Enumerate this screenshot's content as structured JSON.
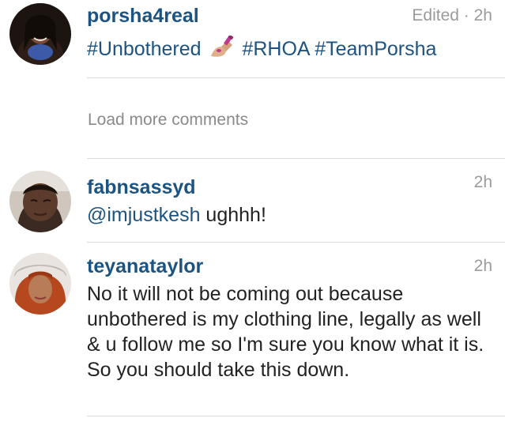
{
  "post": {
    "username": "porsha4real",
    "meta": "Edited · 2h",
    "tag_1": "#Unbothered",
    "emoji_icon": "nail-polish-emoji",
    "tag_2": "#RHOA",
    "tag_3": "#TeamPorsha"
  },
  "load_more_label": "Load more comments",
  "comments": [
    {
      "username": "fabnsassyd",
      "time": "2h",
      "mention": "@imjustkesh",
      "text": " ughhh!"
    },
    {
      "username": "teyanataylor",
      "time": "2h",
      "text": "No it will not be coming out because unbothered is my clothing line, legally as well & u follow me so I'm sure you know what it is. So you should take this down."
    }
  ],
  "colors": {
    "username": "#1d5380",
    "hashtag": "#1d5380",
    "meta": "#9b9b9b",
    "text": "#222222",
    "divider": "#dcdcdc"
  }
}
